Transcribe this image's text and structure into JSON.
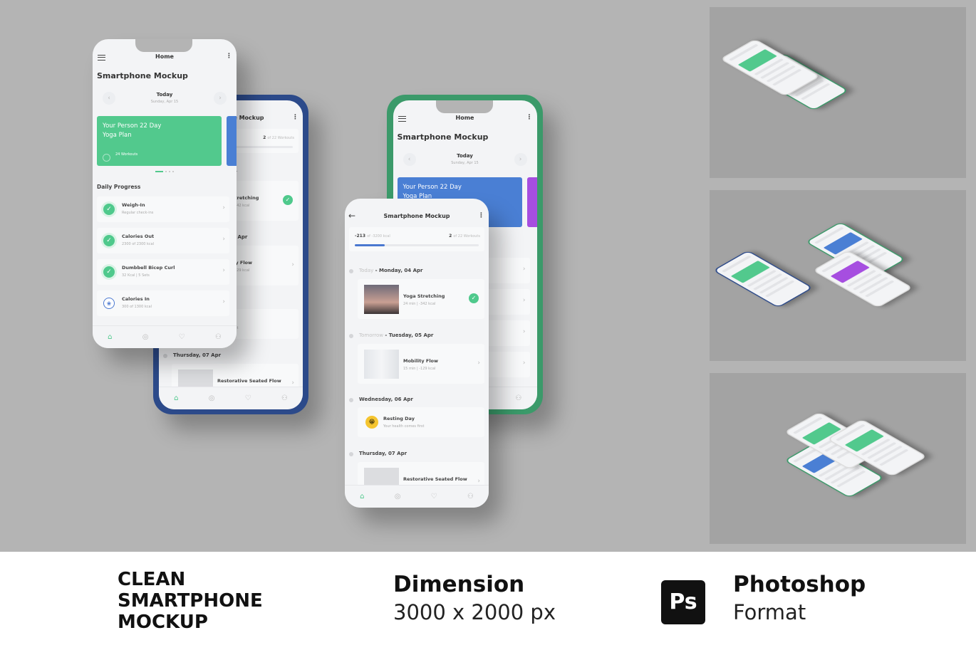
{
  "home": {
    "header": "Home",
    "title": "Smartphone Mockup",
    "today": "Today",
    "date": "Sunday, Apr 15",
    "card_title_1": "Your Person 22 Day",
    "card_title_2": "Yoga Plan",
    "card_sub": "24 Workouts",
    "section": "Daily Progress",
    "rows": [
      {
        "title": "Weigh-In",
        "sub": "Regular check-ins",
        "icon": "check-icon"
      },
      {
        "title": "Calories Out",
        "sub": "2300 of 2300 kcal",
        "icon": "check-icon"
      },
      {
        "title": "Dumbbell Bicep Curl",
        "sub": "32 Kcal | 5 Sets",
        "icon": "check-icon"
      },
      {
        "title": "Calories In",
        "sub": "300 of 1300 kcal",
        "icon": "nutrition-icon"
      }
    ]
  },
  "schedule": {
    "title": "Smartphone Mockup",
    "kcal_value": "-213",
    "kcal_of": "of -3200 kcal",
    "workouts_value": "2",
    "workouts_of": "of 22 Workouts",
    "progress_fraction": 0.24,
    "days": [
      {
        "prefix": "Today",
        "label": " - Monday, 04 Apr",
        "item": "Yoga Stretching",
        "sub": "24 min | -342 kcal"
      },
      {
        "prefix": "Tomorrow",
        "label": " - Tuesday, 05 Apr",
        "item": "Mobility Flow",
        "sub": "15 min | -129 kcal"
      },
      {
        "prefix": "",
        "label": "Wednesday, 06 Apr",
        "item": "Resting Day",
        "sub": "Your health comes first"
      },
      {
        "prefix": "",
        "label": "Thursday, 07 Apr",
        "item": "Restorative Seated Flow",
        "sub": ""
      }
    ]
  },
  "footer": {
    "headline": [
      "CLEAN",
      "SMARTPHONE",
      "MOCKUP"
    ],
    "dimension_label": "Dimension",
    "dimension_value": "3000 x 2000 px",
    "ps_logo": "Ps",
    "format_title": "Photoshop",
    "format_sub": "Format"
  },
  "colors": {
    "green": "#52c98d",
    "blue": "#4a7fd4",
    "purple": "#a64ee0",
    "bezel_blue": "#2c4a8a",
    "bezel_green": "#3b9a6a"
  }
}
